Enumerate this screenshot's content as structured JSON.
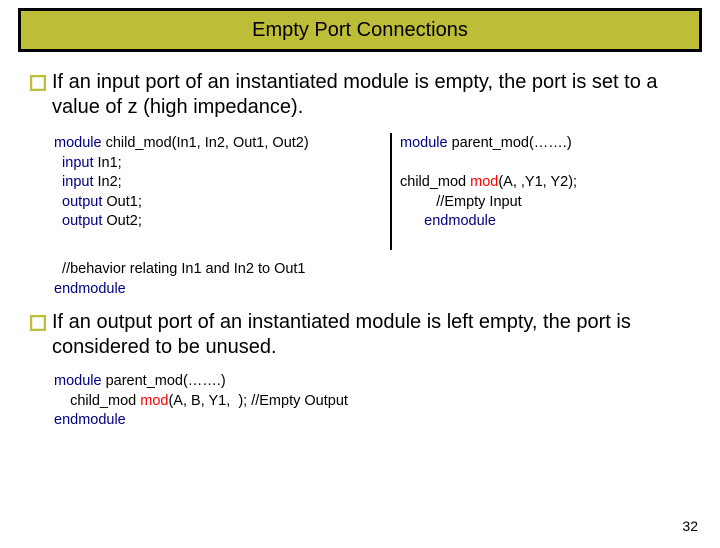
{
  "title": "Empty Port Connections",
  "bullet1": "If an input port of an instantiated module is empty, the port is set to a value of z (high impedance).",
  "codeLeft": {
    "l1a": "module",
    "l1b": " child_mod(In1, In2, Out1, Out2)",
    "l2a": "  input",
    "l2b": " In1;",
    "l3a": "  input",
    "l3b": " In2;",
    "l4a": "  output",
    "l4b": " Out1;",
    "l5a": "  output",
    "l5b": " Out2;"
  },
  "codeRight": {
    "r1a": "module",
    "r1b": " parent_mod(…….)",
    "r2a": "child_mod ",
    "r2b": "mod",
    "r2c": "(A, ,Y1, Y2);",
    "r3": "         //Empty Input",
    "r4a": "endmodule"
  },
  "codeBelow": {
    "b1": "  //behavior relating In1 and In2 to Out1",
    "b2a": "endmodule"
  },
  "bullet2": "If an output port of an instantiated module is left empty, the port is considered to be unused.",
  "code2": {
    "l1a": "module",
    "l1b": " parent_mod(…….)",
    "l2a": "    child_mod ",
    "l2b": "mod",
    "l2c": "(A, B, Y1,  ); //Empty Output",
    "l3a": "endmodule"
  },
  "pageNumber": "32"
}
